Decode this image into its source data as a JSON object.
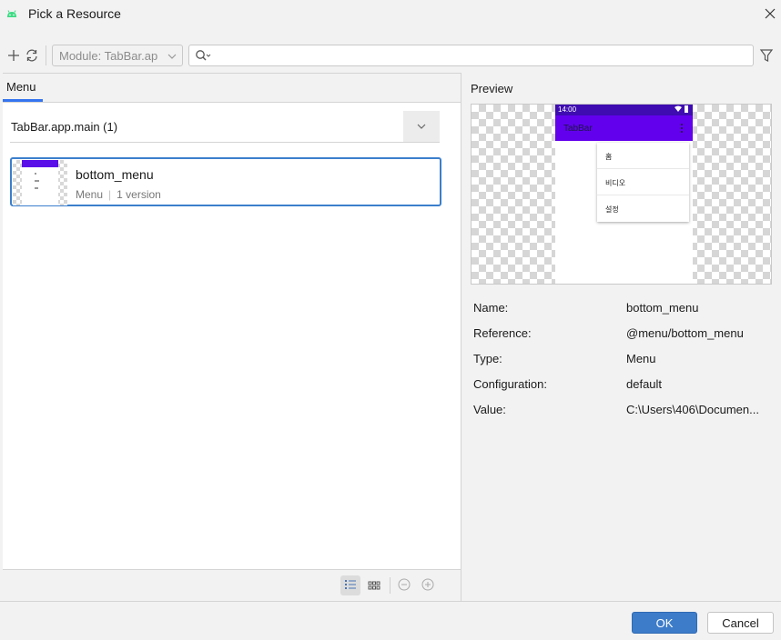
{
  "window": {
    "title": "Pick a Resource"
  },
  "toolbar": {
    "module_label": "Module: TabBar.ap",
    "search_value": ""
  },
  "left": {
    "tab_label": "Menu",
    "group_label": "TabBar.app.main (1)",
    "items": [
      {
        "name": "bottom_menu",
        "type": "Menu",
        "versions": "1 version"
      }
    ]
  },
  "preview": {
    "label": "Preview",
    "status_time": "14:00",
    "app_title": "TabBar",
    "menu_items": [
      "홈",
      "비디오",
      "설정"
    ]
  },
  "properties": [
    {
      "label": "Name:",
      "value": "bottom_menu"
    },
    {
      "label": "Reference:",
      "value": "@menu/bottom_menu"
    },
    {
      "label": "Type:",
      "value": "Menu"
    },
    {
      "label": "Configuration:",
      "value": "default"
    },
    {
      "label": "Value:",
      "value": "C:\\Users\\406\\Documen..."
    }
  ],
  "buttons": {
    "ok": "OK",
    "cancel": "Cancel"
  },
  "colors": {
    "accent": "#3574f0",
    "ok_button": "#3d7cc9",
    "app_bar": "#6200ee",
    "status_bar": "#3e0cb0"
  }
}
